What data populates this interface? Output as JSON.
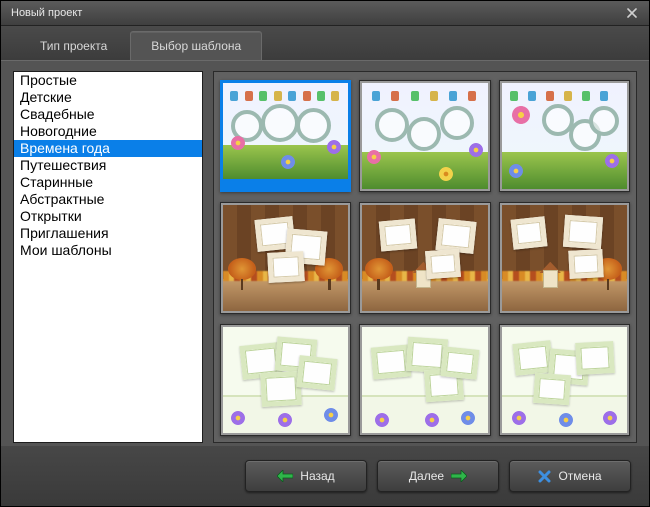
{
  "window": {
    "title": "Новый проект"
  },
  "tabs": [
    {
      "label": "Тип проекта",
      "active": false
    },
    {
      "label": "Выбор шаблона",
      "active": true
    }
  ],
  "categories": {
    "items": [
      "Простые",
      "Детские",
      "Свадебные",
      "Новогодние",
      "Времена года",
      "Путешествия",
      "Старинные",
      "Абстрактные",
      "Открытки",
      "Приглашения",
      "Мои шаблоны"
    ],
    "selected_index": 4
  },
  "templates": {
    "selected_index": 0,
    "items": [
      {
        "id": "spring-rings-1",
        "style": "spring"
      },
      {
        "id": "spring-rings-2",
        "style": "spring"
      },
      {
        "id": "spring-rings-3",
        "style": "spring"
      },
      {
        "id": "autumn-frames-1",
        "style": "autumn"
      },
      {
        "id": "autumn-frames-2",
        "style": "autumn_hut"
      },
      {
        "id": "autumn-frames-3",
        "style": "autumn_hut"
      },
      {
        "id": "summer-frames-1",
        "style": "summer"
      },
      {
        "id": "summer-frames-2",
        "style": "summer"
      },
      {
        "id": "summer-frames-3",
        "style": "summer"
      }
    ]
  },
  "footer": {
    "back": "Назад",
    "next": "Далее",
    "cancel": "Отмена"
  },
  "colors": {
    "selection": "#0a7fe8",
    "arrow_green": "#2fb64a",
    "cancel_x": "#2f78d6"
  }
}
